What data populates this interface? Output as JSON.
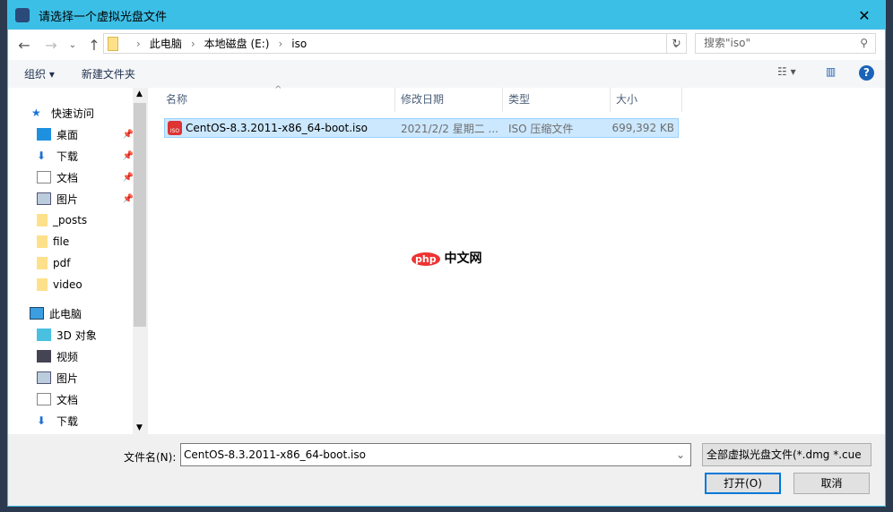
{
  "window": {
    "title": "请选择一个虚拟光盘文件",
    "close": "✕"
  },
  "address": {
    "segments": [
      "此电脑",
      "本地磁盘 (E:)",
      "iso"
    ],
    "search_placeholder": "搜索\"iso\""
  },
  "toolbar": {
    "organize": "组织 ▾",
    "new_folder": "新建文件夹",
    "help": "?"
  },
  "nav": {
    "quick_access": "快速访问",
    "items": [
      {
        "label": "桌面",
        "pinned": true
      },
      {
        "label": "下载",
        "pinned": true
      },
      {
        "label": "文档",
        "pinned": true
      },
      {
        "label": "图片",
        "pinned": true
      },
      {
        "label": "_posts"
      },
      {
        "label": "file"
      },
      {
        "label": "pdf"
      },
      {
        "label": "video"
      }
    ],
    "this_pc": "此电脑",
    "pc_items": [
      "3D 对象",
      "视频",
      "图片",
      "文档",
      "下载"
    ]
  },
  "columns": [
    "名称",
    "修改日期",
    "类型",
    "大小"
  ],
  "files": [
    {
      "name": "CentOS-8.3.2011-x86_64-boot.iso",
      "modified": "2021/2/2 星期二 ...",
      "type": "ISO 压缩文件",
      "size": "699,392 KB"
    }
  ],
  "watermark": "php中文网",
  "bottom": {
    "filename_label": "文件名(N):",
    "filename": "CentOS-8.3.2011-x86_64-boot.iso",
    "filter": "全部虚拟光盘文件(*.dmg *.cue",
    "open": "打开(O)",
    "cancel": "取消"
  }
}
